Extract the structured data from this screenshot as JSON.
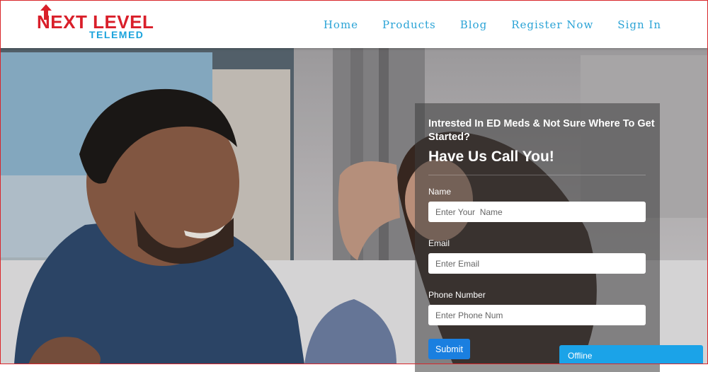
{
  "logo": {
    "line1": "NEXT LEVEL",
    "line2": "TELEMED"
  },
  "nav": [
    "Home",
    "Products",
    "Blog",
    "Register Now",
    "Sign In"
  ],
  "form": {
    "question": "Intrested In ED Meds & Not Sure Where To Get Started?",
    "heading": "Have Us Call You!",
    "name_label": "Name",
    "name_placeholder": "Enter Your  Name",
    "email_label": "Email",
    "email_placeholder": "Enter Email",
    "phone_label": "Phone Number",
    "phone_placeholder": "Enter Phone Num",
    "submit_label": "Submit"
  },
  "chat": {
    "status": "Offline"
  },
  "colors": {
    "brand_red": "#d91f2a",
    "brand_blue": "#1aa3dc",
    "nav_link": "#2aa3d6",
    "submit": "#1a7fe0",
    "chat": "#1ba3e8"
  }
}
